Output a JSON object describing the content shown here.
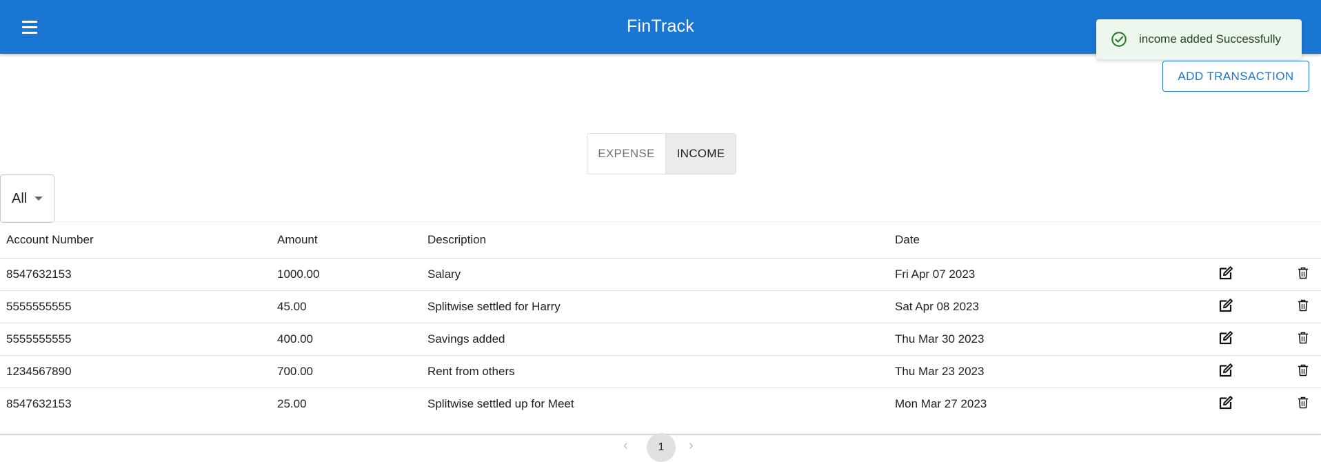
{
  "appbar": {
    "title": "FinTrack",
    "menu_icon": "hamburger-menu-icon"
  },
  "notification": {
    "message": "income added Successfully",
    "icon": "check-circle-icon",
    "color": "#2e7d32",
    "background": "#edf7ed"
  },
  "actions": {
    "add_transaction_label": "ADD TRANSACTION"
  },
  "type_toggle": {
    "options": [
      "EXPENSE",
      "INCOME"
    ],
    "selected": "INCOME"
  },
  "filter": {
    "selected": "All"
  },
  "table": {
    "headers": [
      "Account Number",
      "Amount",
      "Description",
      "Date"
    ],
    "rows": [
      {
        "account": "8547632153",
        "amount": "1000.00",
        "description": "Salary",
        "date": "Fri Apr 07 2023"
      },
      {
        "account": "5555555555",
        "amount": "45.00",
        "description": "Splitwise settled for Harry",
        "date": "Sat Apr 08 2023"
      },
      {
        "account": "5555555555",
        "amount": "400.00",
        "description": "Savings added",
        "date": "Thu Mar 30 2023"
      },
      {
        "account": "1234567890",
        "amount": "700.00",
        "description": "Rent from others",
        "date": "Thu Mar 23 2023"
      },
      {
        "account": "8547632153",
        "amount": "25.00",
        "description": "Splitwise settled up for Meet",
        "date": "Mon Mar 27 2023"
      }
    ],
    "row_icons": [
      "edit-icon",
      "delete-icon"
    ]
  },
  "pagination": {
    "current_page": "1",
    "prev_icon": "chevron-left-icon",
    "next_icon": "chevron-right-icon"
  },
  "colors": {
    "primary": "#1976d2"
  }
}
